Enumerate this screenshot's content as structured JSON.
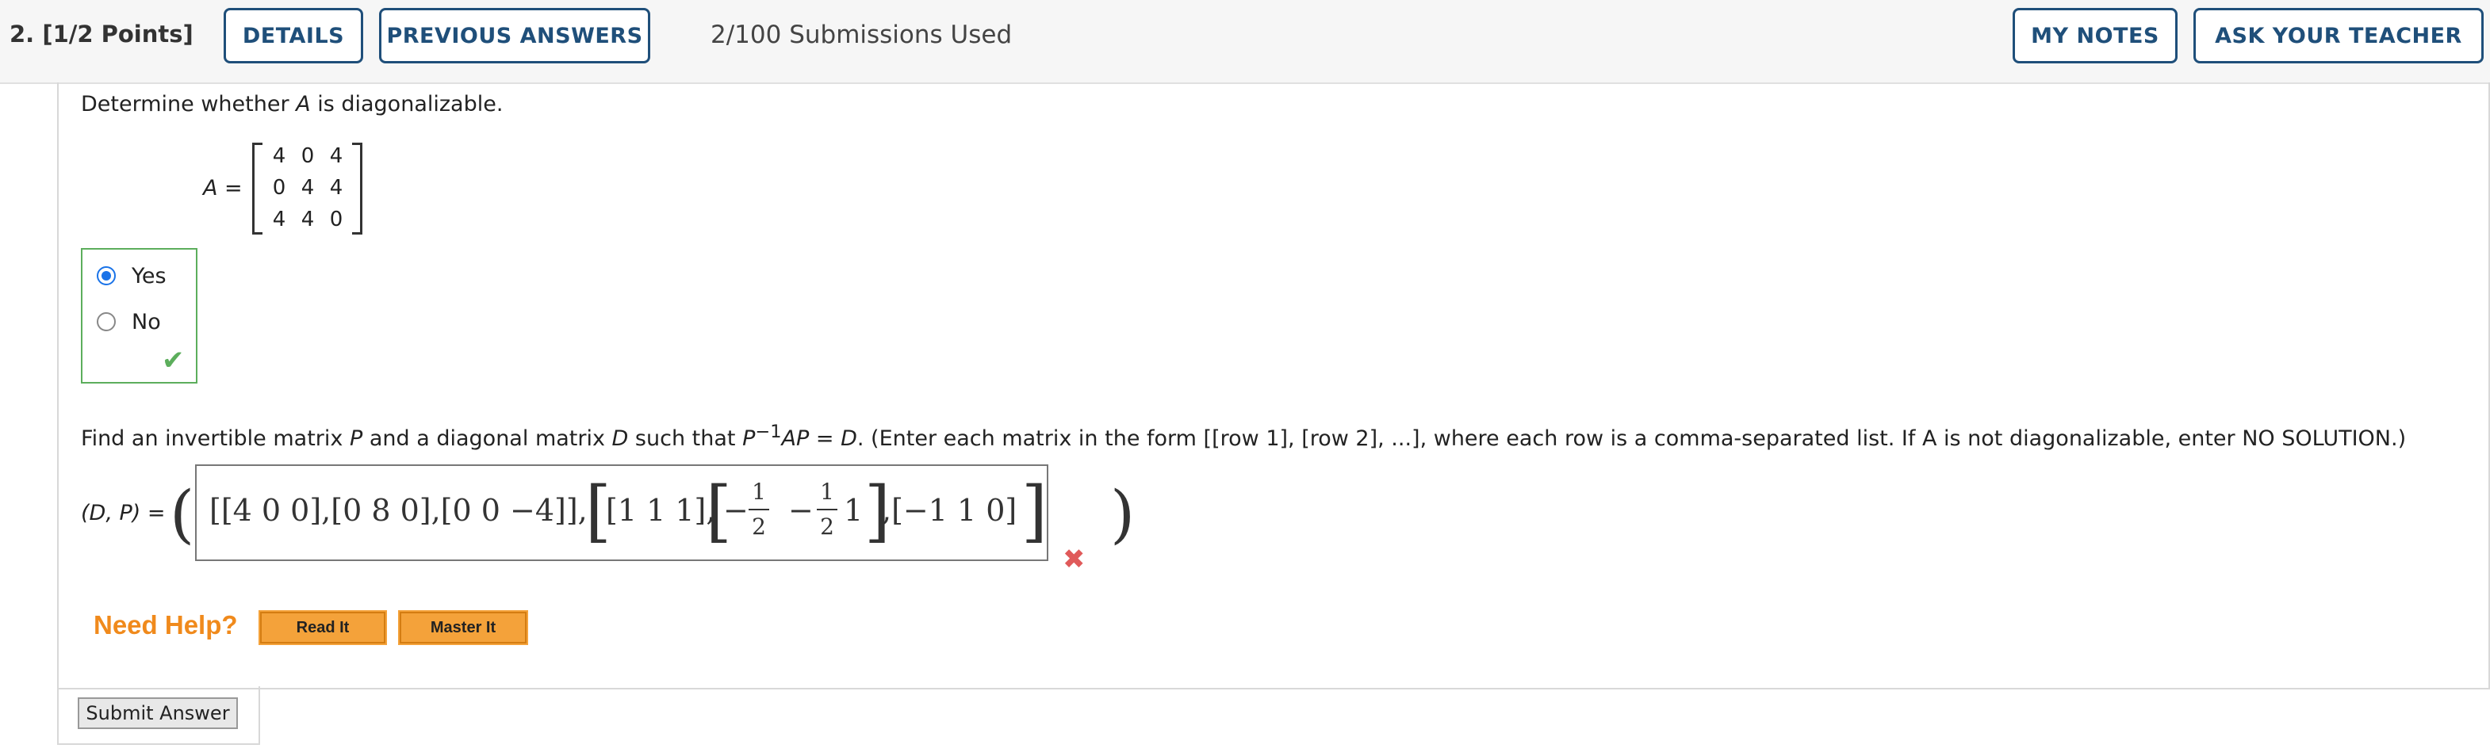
{
  "header": {
    "question_number": "2.",
    "points": "[1/2 Points]",
    "details_label": "DETAILS",
    "previous_answers_label": "PREVIOUS ANSWERS",
    "submissions": "2/100 Submissions Used",
    "my_notes_label": "MY NOTES",
    "ask_teacher_label": "ASK YOUR TEACHER"
  },
  "question": {
    "prompt_prefix": "Determine whether ",
    "prompt_var": "A",
    "prompt_suffix": " is diagonalizable.",
    "matrix_label": "A =",
    "matrix": [
      [
        "4",
        "0",
        "4"
      ],
      [
        "0",
        "4",
        "4"
      ],
      [
        "4",
        "4",
        "0"
      ]
    ],
    "choices": [
      {
        "label": "Yes",
        "selected": true
      },
      {
        "label": "No",
        "selected": false
      }
    ],
    "choice_result": "correct",
    "part2_prefix": "Find an invertible matrix ",
    "part2_P": "P",
    "part2_mid1": " and a diagonal matrix ",
    "part2_D": "D",
    "part2_mid2": " such that ",
    "part2_eq_P": "P",
    "part2_eq_exp": "−1",
    "part2_eq_rest": "AP",
    "part2_eq_eq": " = ",
    "part2_eq_D": "D",
    "part2_instructions": ". (Enter each matrix in the form [[row 1], [row 2], ...], where each row is a comma-separated list. If A is not diagonalizable, enter NO SOLUTION.)",
    "answer_label": "(D, P) =",
    "answer_D": "[[4 0 0],[0 8 0],[0 0 −4]],",
    "answer_P_first": "[1 1 1],",
    "answer_P_frac_sign": "−",
    "answer_P_frac_num": "1",
    "answer_P_frac_den": "2",
    "answer_P_minus": "−",
    "answer_P_frac2_num": "1",
    "answer_P_frac2_den": "2",
    "answer_P_one": "1",
    "answer_P_last": ",[−1 1 0]",
    "answer_result": "incorrect"
  },
  "help": {
    "label": "Need Help?",
    "read_it": "Read It",
    "master_it": "Master It"
  },
  "submit_label": "Submit Answer"
}
